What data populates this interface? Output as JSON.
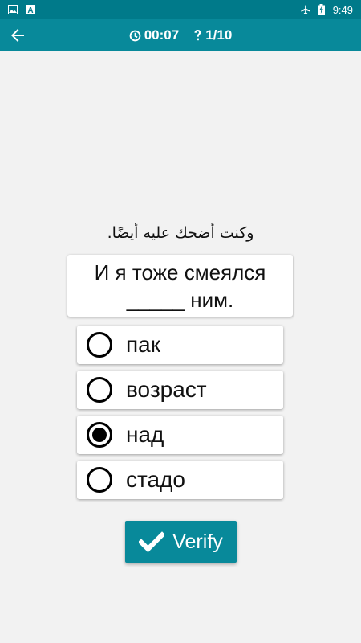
{
  "status_bar": {
    "time": "9:49",
    "left_icons": [
      "image-icon",
      "a-icon"
    ],
    "right_icons": [
      "airplane-icon",
      "battery-charging-icon"
    ]
  },
  "app_bar": {
    "timer_icon": "clock-icon",
    "timer": "00:07",
    "progress_icon": "question-icon",
    "progress": "1/10",
    "bg_color": "#08899a"
  },
  "prompt": {
    "arabic": "وكنت أضحك عليه أيضًا.",
    "sentence_line1": "И я тоже смеялся",
    "sentence_line2": "_____ ним."
  },
  "options": [
    {
      "label": "пак",
      "selected": false
    },
    {
      "label": "возраст",
      "selected": false
    },
    {
      "label": "над",
      "selected": true
    },
    {
      "label": "стадо",
      "selected": false
    }
  ],
  "verify_button": {
    "label": "Verify",
    "icon": "check-icon"
  }
}
